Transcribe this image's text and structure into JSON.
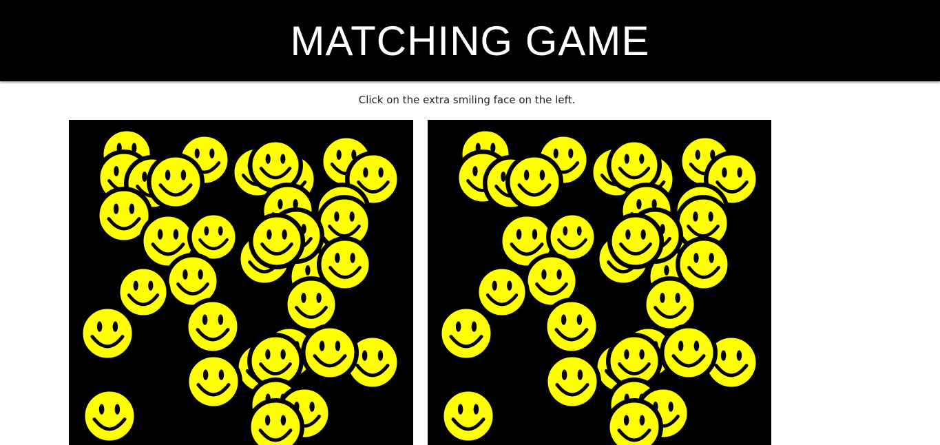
{
  "header": {
    "title": "MATCHING GAME"
  },
  "instructions": "Click on the extra smiling face on the left.",
  "colors": {
    "header_background": "#000000",
    "title_text": "#ffffff",
    "board_background": "#000000",
    "face_fill": "#ffff00",
    "face_outline": "#000000"
  },
  "boards": {
    "left": {
      "role": "left board",
      "face_count": 33,
      "contains_extra_face": true
    },
    "right": {
      "role": "right board",
      "face_count": 32
    }
  },
  "icons": {
    "face": "smiley-face-icon"
  }
}
